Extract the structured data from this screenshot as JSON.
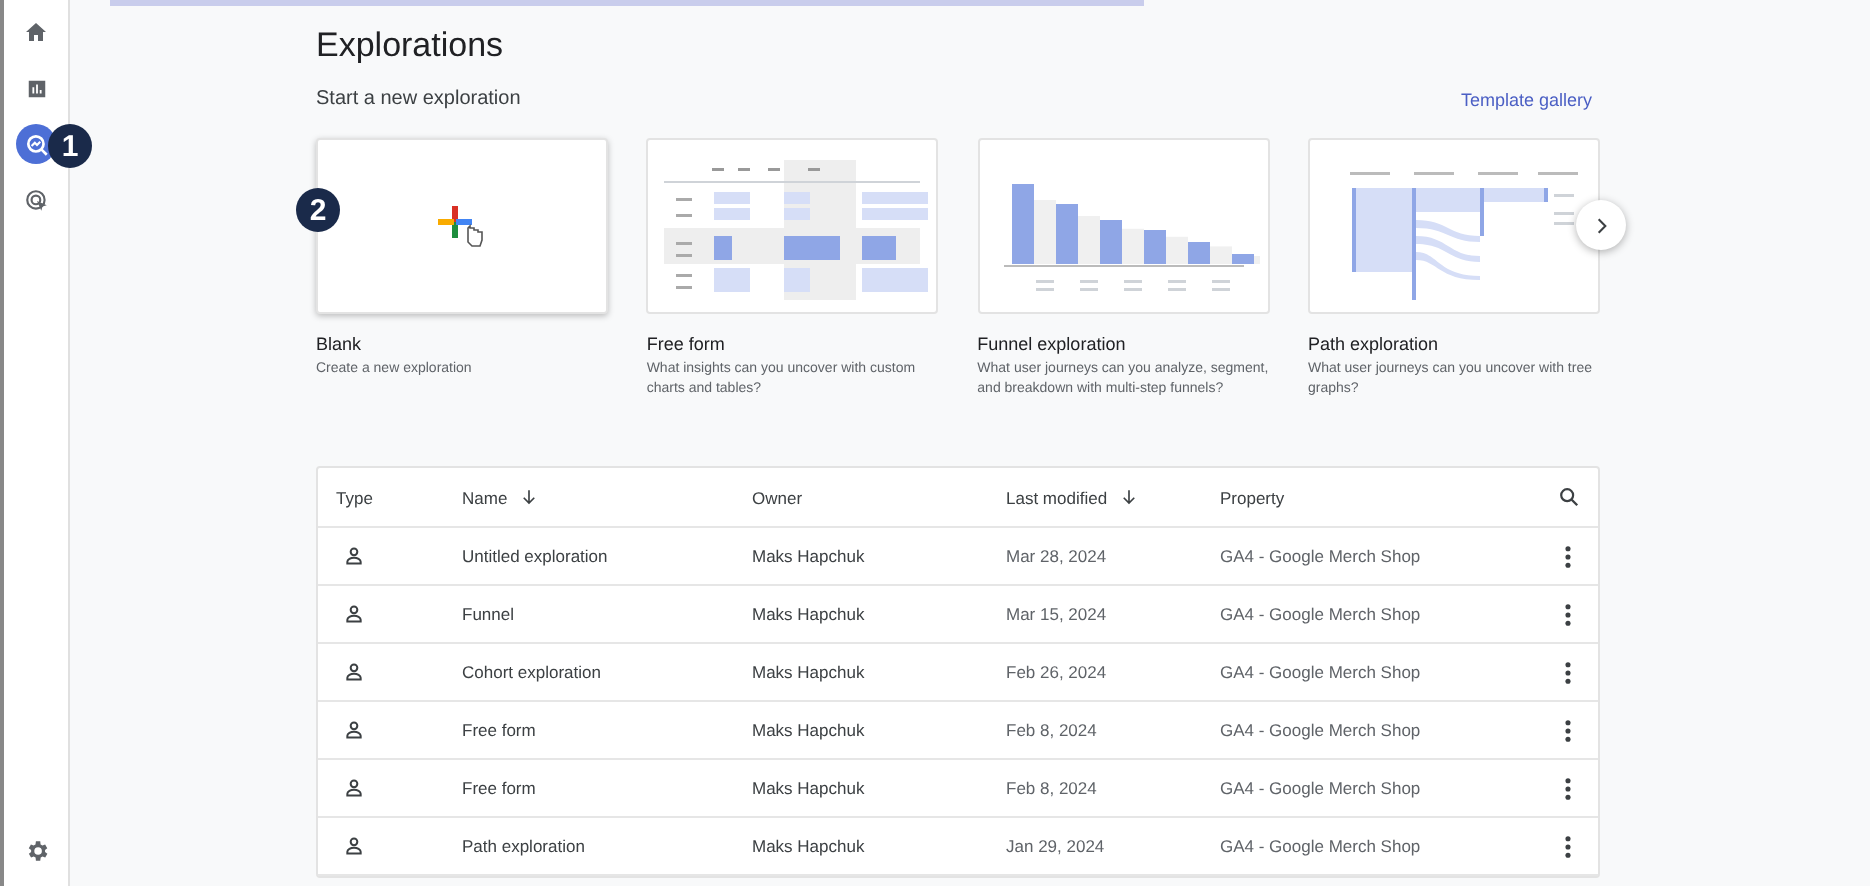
{
  "sidebar": {
    "items": [
      {
        "kind": "home",
        "selected": false
      },
      {
        "kind": "reports",
        "selected": false
      },
      {
        "kind": "explore",
        "selected": true
      },
      {
        "kind": "advertising",
        "selected": false
      }
    ],
    "settings": {
      "kind": "settings"
    }
  },
  "sidebar_badge": {
    "label": "1"
  },
  "card_badge": {
    "label": "2"
  },
  "page": {
    "title": "Explorations",
    "subtitle": "Start a new exploration",
    "template_link": "Template gallery"
  },
  "templates": [
    {
      "kind": "blank",
      "title": "Blank",
      "description": "Create a new exploration"
    },
    {
      "kind": "free_form",
      "title": "Free form",
      "description": "What insights can you uncover with custom charts and tables?"
    },
    {
      "kind": "funnel",
      "title": "Funnel exploration",
      "description": "What user journeys can you analyze, segment, and breakdown with multi-step funnels?"
    },
    {
      "kind": "path",
      "title": "Path exploration",
      "description": "What user journeys can you uncover with tree graphs?"
    }
  ],
  "table": {
    "columns": [
      {
        "label": "Type",
        "sorted": false
      },
      {
        "label": "Name",
        "sorted": true
      },
      {
        "label": "Owner",
        "sorted": false
      },
      {
        "label": "Last modified",
        "sorted": true
      },
      {
        "label": "Property",
        "sorted": false
      }
    ],
    "rows": [
      {
        "name": "Untitled exploration",
        "owner": "Maks Hapchuk",
        "modified": "Mar 28, 2024",
        "property": "GA4 - Google Merch Shop"
      },
      {
        "name": "Funnel",
        "owner": "Maks Hapchuk",
        "modified": "Mar 15, 2024",
        "property": "GA4 - Google Merch Shop"
      },
      {
        "name": "Cohort exploration",
        "owner": "Maks Hapchuk",
        "modified": "Feb 26, 2024",
        "property": "GA4 - Google Merch Shop"
      },
      {
        "name": "Free form",
        "owner": "Maks Hapchuk",
        "modified": "Feb 8, 2024",
        "property": "GA4 - Google Merch Shop"
      },
      {
        "name": "Free form",
        "owner": "Maks Hapchuk",
        "modified": "Feb 8, 2024",
        "property": "GA4 - Google Merch Shop"
      },
      {
        "name": "Path exploration",
        "owner": "Maks Hapchuk",
        "modified": "Jan 29, 2024",
        "property": "GA4 - Google Merch Shop"
      }
    ]
  }
}
